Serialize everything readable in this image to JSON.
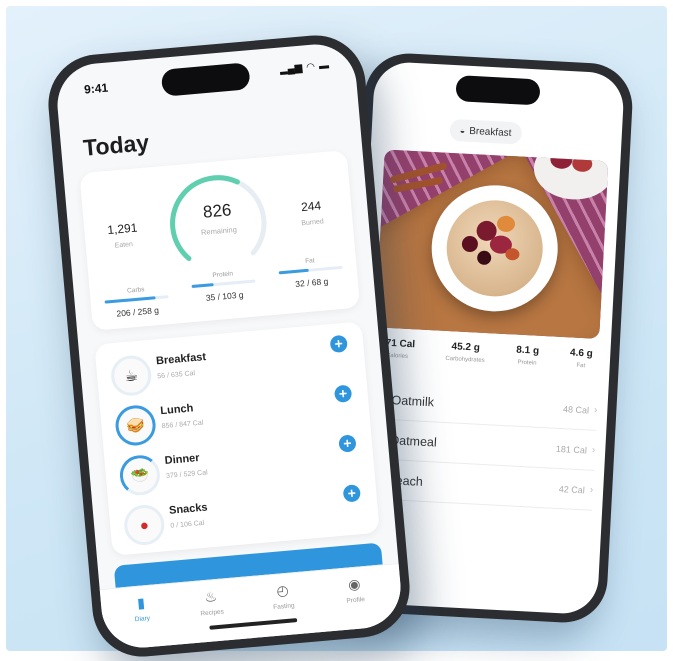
{
  "colors": {
    "accent": "#2f95dc",
    "ring": "#5fcfb0",
    "background": "#cfe7f6"
  },
  "front_phone": {
    "status_time": "9:41",
    "status_icons": [
      "signal-icon",
      "wifi-icon",
      "battery-icon"
    ],
    "title": "Today",
    "summary": {
      "eaten_value": "1,291",
      "eaten_label": "Eaten",
      "remaining_value": "826",
      "remaining_label": "Remaining",
      "remaining_progress": 0.61,
      "burned_value": "244",
      "burned_label": "Burned"
    },
    "macros": [
      {
        "label": "Carbs",
        "value": "206 / 258 g",
        "progress": 0.8
      },
      {
        "label": "Protein",
        "value": "35 / 103 g",
        "progress": 0.34
      },
      {
        "label": "Fat",
        "value": "32 / 68 g",
        "progress": 0.47
      }
    ],
    "meals": [
      {
        "name": "Breakfast",
        "calories": "56 / 635 Cal",
        "icon": "coffee-icon"
      },
      {
        "name": "Lunch",
        "calories": "856 / 847 Cal",
        "icon": "sandwich-icon"
      },
      {
        "name": "Dinner",
        "calories": "379 / 529 Cal",
        "icon": "salad-icon"
      },
      {
        "name": "Snacks",
        "calories": "0 / 106 Cal",
        "icon": "apple-icon"
      }
    ],
    "tabs": [
      {
        "label": "Diary",
        "icon": "book-icon",
        "active": true
      },
      {
        "label": "Recipes",
        "icon": "chef-hat-icon",
        "active": false
      },
      {
        "label": "Fasting",
        "icon": "timer-icon",
        "active": false
      },
      {
        "label": "Profile",
        "icon": "user-icon",
        "active": false
      }
    ]
  },
  "back_phone": {
    "meal_label": "Breakfast",
    "nutrition": [
      {
        "value": "271 Cal",
        "label": "Calories"
      },
      {
        "value": "45.2 g",
        "label": "Carbohydrates"
      },
      {
        "value": "8.1 g",
        "label": "Protein"
      },
      {
        "value": "4.6 g",
        "label": "Fat"
      }
    ],
    "ingredients": [
      {
        "name": "Oatmilk",
        "calories": "48 Cal",
        "icon": "milk-icon"
      },
      {
        "name": "Oatmeal",
        "calories": "181 Cal",
        "icon": "wheat-icon"
      },
      {
        "name": "Peach",
        "calories": "42 Cal",
        "icon": "peach-icon"
      }
    ]
  }
}
